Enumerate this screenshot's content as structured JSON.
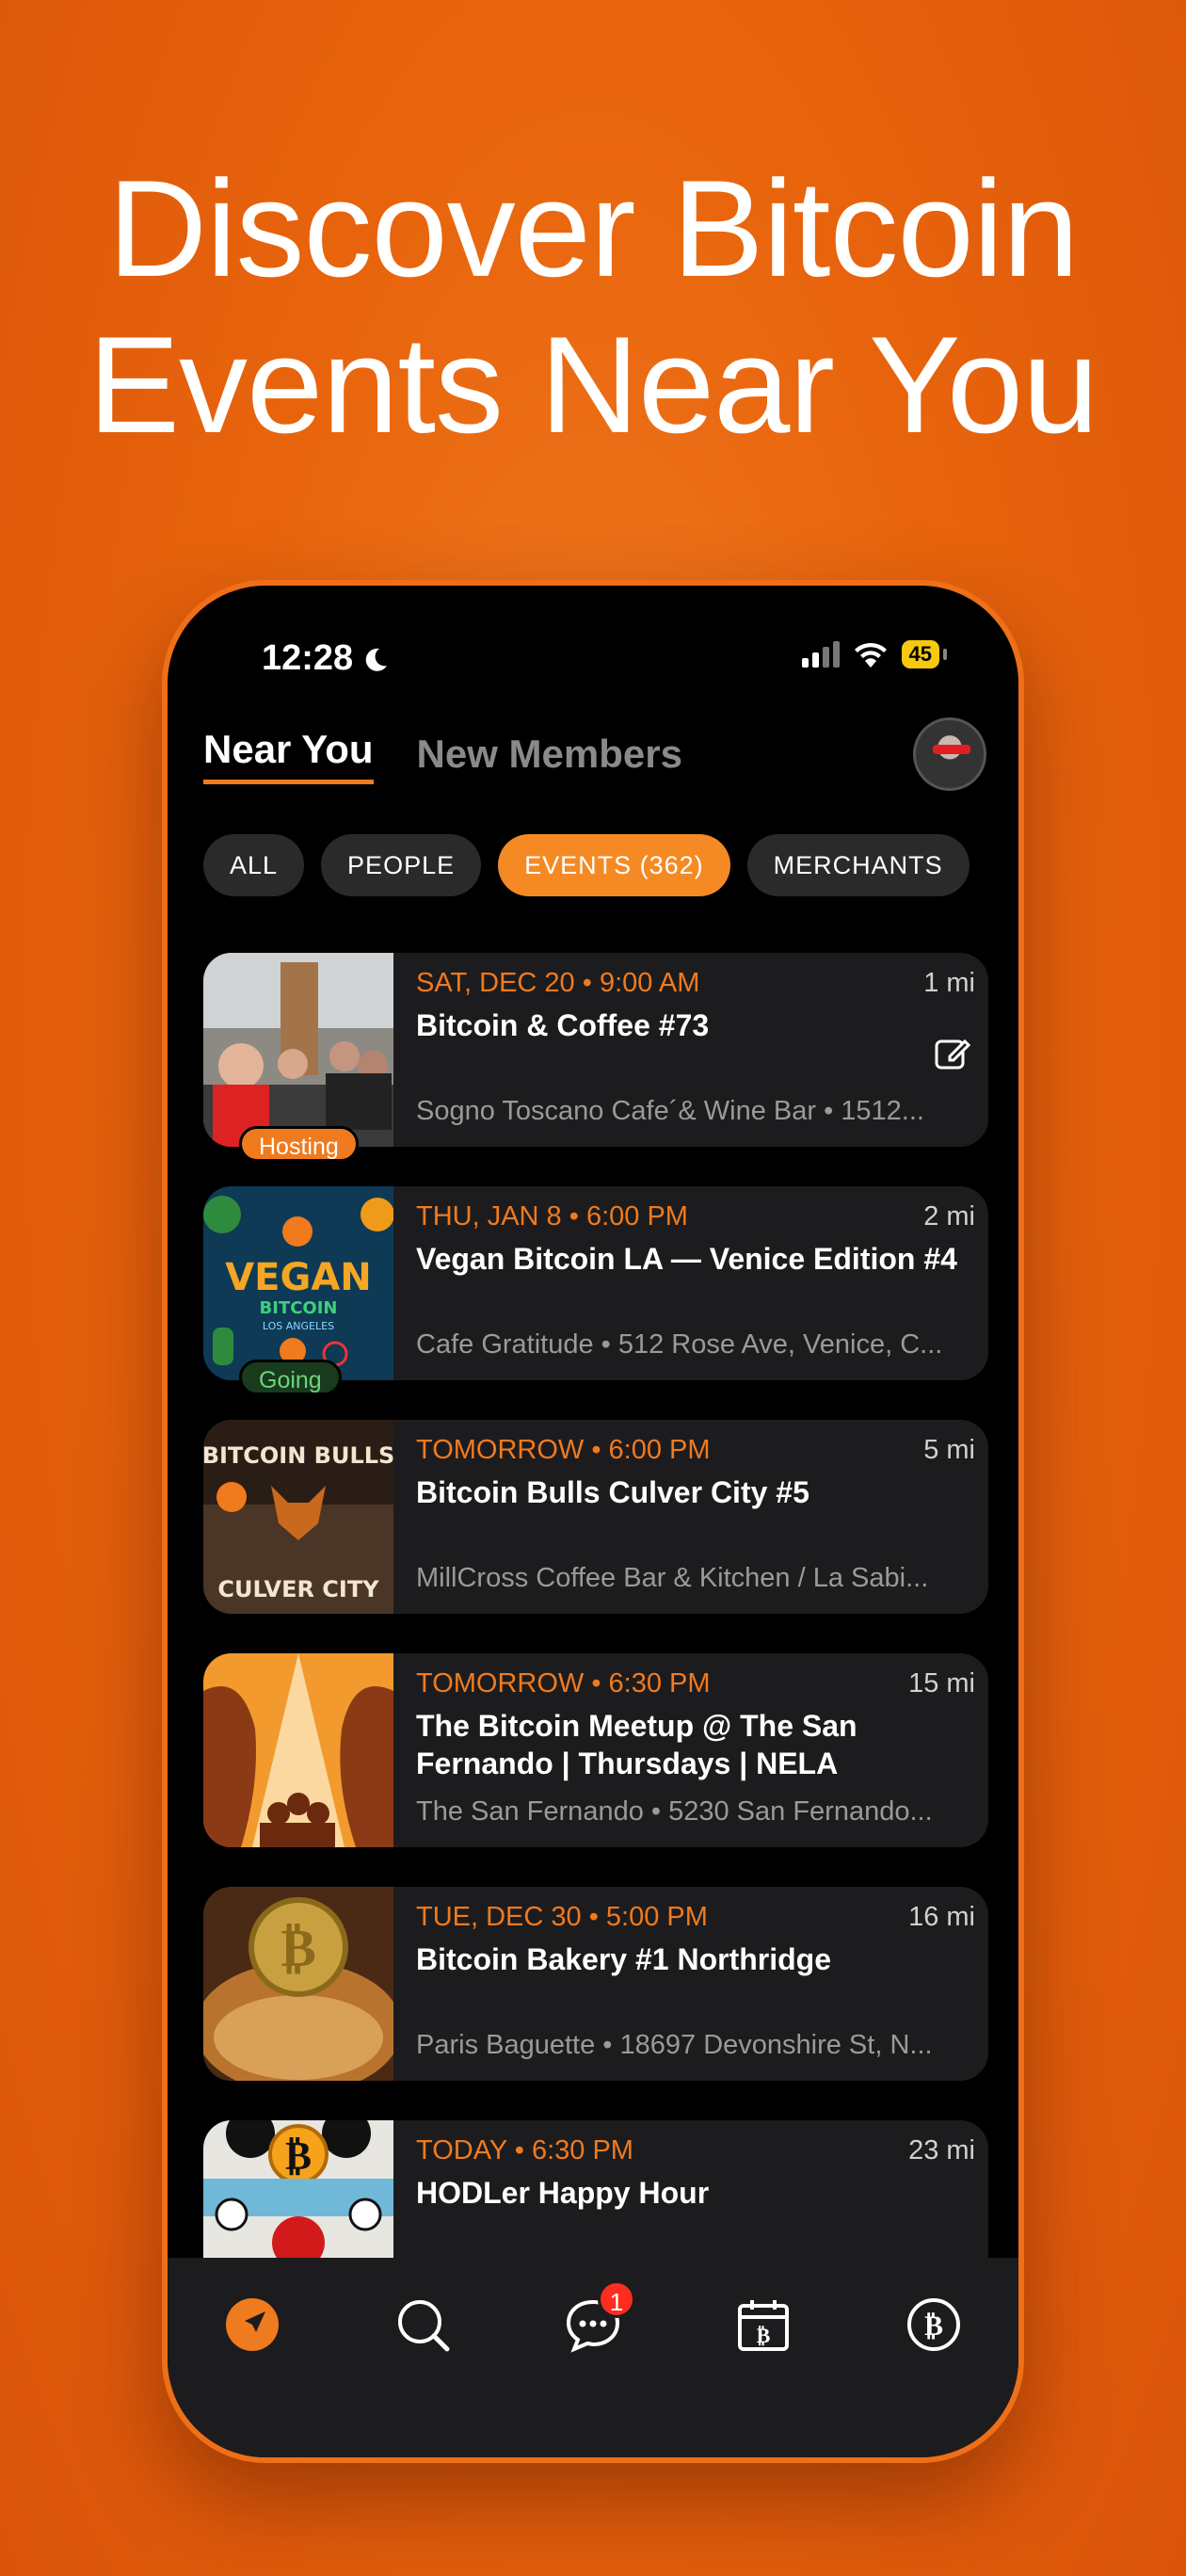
{
  "headline": [
    "Discover Bitcoin",
    "Events Near You"
  ],
  "status": {
    "time": "12:28",
    "battery": "45"
  },
  "tabs": [
    {
      "label": "Near You",
      "active": true
    },
    {
      "label": "New Members",
      "active": false
    }
  ],
  "filters": [
    {
      "label": "ALL",
      "active": false
    },
    {
      "label": "PEOPLE",
      "active": false
    },
    {
      "label": "EVENTS (362)",
      "active": true
    },
    {
      "label": "MERCHANTS",
      "active": false
    }
  ],
  "events": [
    {
      "when": "SAT, DEC 20 • 9:00 AM",
      "distance": "1 mi",
      "title": "Bitcoin & Coffee #73",
      "place": "Sogno Toscano Cafe´& Wine Bar • 1512...",
      "badge": "Hosting"
    },
    {
      "when": "THU, JAN 8 • 6:00 PM",
      "distance": "2 mi",
      "title": "Vegan Bitcoin LA — Venice Edition #4",
      "place": "Cafe Gratitude • 512 Rose Ave, Venice, C...",
      "badge": "Going"
    },
    {
      "when": "TOMORROW • 6:00 PM",
      "distance": "5 mi",
      "title": "Bitcoin Bulls Culver City #5",
      "place": "MillCross Coffee Bar & Kitchen / La Sabi..."
    },
    {
      "when": "TOMORROW • 6:30 PM",
      "distance": "15 mi",
      "title": "The Bitcoin Meetup @ The San Fernando | Thursdays | NELA",
      "place": "The San Fernando • 5230 San Fernando..."
    },
    {
      "when": "TUE, DEC 30 • 5:00 PM",
      "distance": "16 mi",
      "title": "Bitcoin Bakery #1 Northridge",
      "place": "Paris Baguette • 18697 Devonshire St, N..."
    },
    {
      "when": "TODAY • 6:30 PM",
      "distance": "23 mi",
      "title": "HODLer Happy Hour",
      "place": ""
    }
  ],
  "thumbs": {
    "vegan_text": "VEGAN",
    "vegan_sub": "BITCOIN",
    "vegan_city": "LOS ANGELES",
    "bulls_top": "BITCOIN BULLS",
    "bulls_bottom": "CULVER CITY"
  },
  "tabbar": {
    "items": [
      "navigate-icon",
      "search-icon",
      "messages-icon",
      "calendar-bitcoin-icon",
      "bitcoin-icon"
    ],
    "messages_count": "1"
  },
  "colors": {
    "accent": "#f07a1e",
    "background": "#e8640c"
  }
}
